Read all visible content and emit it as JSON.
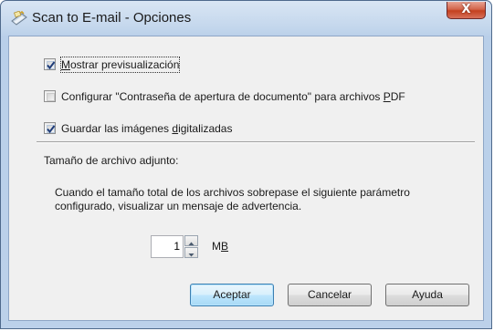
{
  "window": {
    "title": "Scan to E-mail - Opciones",
    "close_glyph": "X",
    "app_icon": "scanner-app-icon"
  },
  "options": {
    "show_preview": {
      "pre": "",
      "accel": "M",
      "post": "ostrar previsualización",
      "checked": true
    },
    "configure_pdf_password": {
      "pre": "Configurar \"Contraseña de apertura de documento\" para archivos ",
      "accel": "P",
      "post": "DF",
      "checked": false
    },
    "save_scanned": {
      "pre": "Guardar las imágenes ",
      "accel": "d",
      "post": "igitalizadas",
      "checked": true
    }
  },
  "attachment": {
    "heading": "Tamaño de archivo adjunto:",
    "description_line1": "Cuando el tamaño total de los archivos sobrepase el siguiente parámetro",
    "description_line2": "configurado, visualizar un mensaje de advertencia.",
    "size_value": "1",
    "unit_pre": "M",
    "unit_accel": "B"
  },
  "buttons": {
    "accept": "Aceptar",
    "cancel": "Cancelar",
    "help": "Ayuda"
  },
  "colors": {
    "accent": "#3c7fb1",
    "checkmark": "#1f3c78",
    "close": "#c4401f"
  }
}
